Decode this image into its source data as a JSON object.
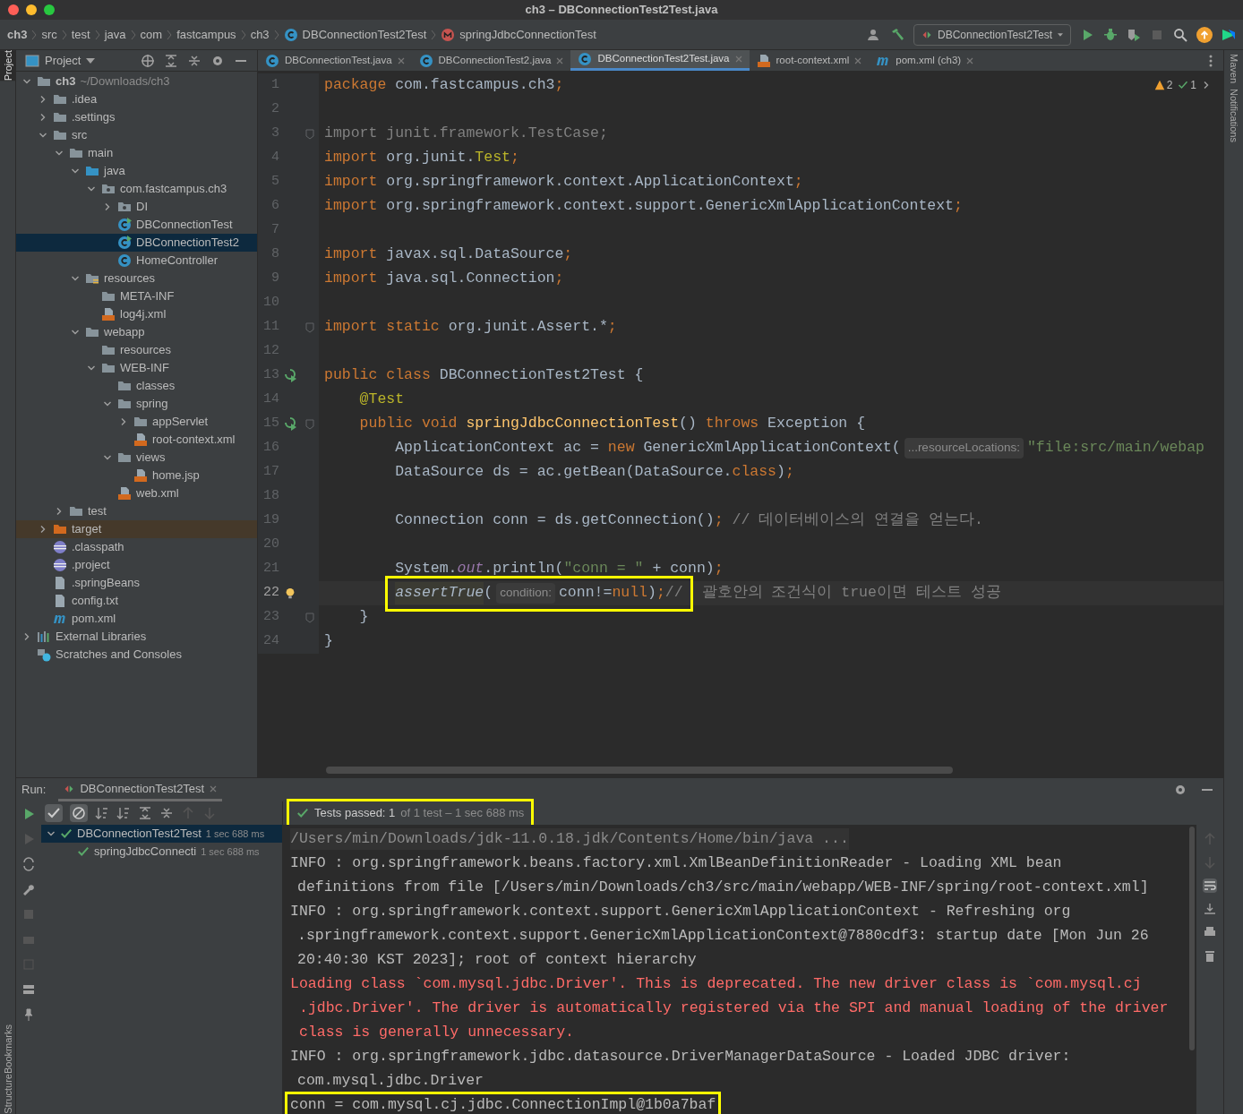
{
  "window": {
    "title": "ch3 – DBConnectionTest2Test.java"
  },
  "breadcrumbs": [
    {
      "label": "ch3",
      "kind": "root"
    },
    {
      "label": "src",
      "kind": "folder"
    },
    {
      "label": "test",
      "kind": "folder"
    },
    {
      "label": "java",
      "kind": "folder"
    },
    {
      "label": "com",
      "kind": "folder"
    },
    {
      "label": "fastcampus",
      "kind": "folder"
    },
    {
      "label": "ch3",
      "kind": "folder"
    },
    {
      "label": "DBConnectionTest2Test",
      "kind": "class"
    },
    {
      "label": "springJdbcConnectionTest",
      "kind": "method"
    }
  ],
  "run_config": {
    "label": "DBConnectionTest2Test"
  },
  "left_top_tool_windows": [
    {
      "label": "Project",
      "selected": true
    }
  ],
  "left_bottom_tool_windows": [
    {
      "label": "Bookmarks",
      "selected": false
    },
    {
      "label": "Structure",
      "selected": false
    }
  ],
  "right_tool_windows": [
    {
      "label": "Maven"
    },
    {
      "label": "Notifications"
    }
  ],
  "project_panel": {
    "title": "Project",
    "items": [
      {
        "label": "ch3",
        "path": "~/Downloads/ch3",
        "kind": "module",
        "expanded": true,
        "selected": false,
        "children": [
          {
            "label": ".idea",
            "kind": "folder",
            "expanded": false,
            "selected": false
          },
          {
            "label": ".settings",
            "kind": "folder",
            "expanded": false,
            "selected": false
          },
          {
            "label": "src",
            "kind": "folder",
            "expanded": true,
            "selected": false,
            "children": [
              {
                "label": "main",
                "kind": "folder",
                "expanded": true,
                "selected": false,
                "children": [
                  {
                    "label": "java",
                    "kind": "source-folder",
                    "expanded": true,
                    "selected": false,
                    "children": [
                      {
                        "label": "com.fastcampus.ch3",
                        "kind": "package",
                        "expanded": true,
                        "selected": false,
                        "children": [
                          {
                            "label": "DI",
                            "kind": "package",
                            "expanded": false,
                            "selected": false
                          },
                          {
                            "label": "DBConnectionTest",
                            "kind": "test-class",
                            "selected": false
                          },
                          {
                            "label": "DBConnectionTest2",
                            "kind": "test-class",
                            "selected": true
                          },
                          {
                            "label": "HomeController",
                            "kind": "class",
                            "selected": false
                          }
                        ]
                      }
                    ]
                  },
                  {
                    "label": "resources",
                    "kind": "resources-folder",
                    "expanded": true,
                    "selected": false,
                    "children": [
                      {
                        "label": "META-INF",
                        "kind": "folder",
                        "selected": false
                      },
                      {
                        "label": "log4j.xml",
                        "kind": "xml",
                        "selected": false
                      }
                    ]
                  },
                  {
                    "label": "webapp",
                    "kind": "folder",
                    "expanded": true,
                    "selected": false,
                    "children": [
                      {
                        "label": "resources",
                        "kind": "folder",
                        "selected": false
                      },
                      {
                        "label": "WEB-INF",
                        "kind": "folder",
                        "expanded": true,
                        "selected": false,
                        "children": [
                          {
                            "label": "classes",
                            "kind": "folder",
                            "selected": false
                          },
                          {
                            "label": "spring",
                            "kind": "folder",
                            "expanded": true,
                            "selected": false,
                            "children": [
                              {
                                "label": "appServlet",
                                "kind": "folder",
                                "expanded": false,
                                "selected": false
                              },
                              {
                                "label": "root-context.xml",
                                "kind": "xml",
                                "selected": false
                              }
                            ]
                          },
                          {
                            "label": "views",
                            "kind": "folder",
                            "expanded": true,
                            "selected": false,
                            "children": [
                              {
                                "label": "home.jsp",
                                "kind": "jsp",
                                "selected": false
                              }
                            ]
                          },
                          {
                            "label": "web.xml",
                            "kind": "xml",
                            "selected": false
                          }
                        ]
                      }
                    ]
                  }
                ]
              },
              {
                "label": "test",
                "kind": "folder",
                "expanded": false,
                "selected": false
              }
            ]
          },
          {
            "label": "target",
            "kind": "excluded-folder",
            "expanded": false,
            "selected": false
          },
          {
            "label": ".classpath",
            "kind": "eclipse",
            "selected": false
          },
          {
            "label": ".project",
            "kind": "eclipse",
            "selected": false
          },
          {
            "label": ".springBeans",
            "kind": "text",
            "selected": false
          },
          {
            "label": "config.txt",
            "kind": "text",
            "selected": false
          },
          {
            "label": "pom.xml",
            "kind": "maven",
            "selected": false
          }
        ]
      },
      {
        "label": "External Libraries",
        "kind": "libraries",
        "expanded": false,
        "selected": false
      },
      {
        "label": "Scratches and Consoles",
        "kind": "scratches",
        "selected": false
      }
    ]
  },
  "editor_tabs": [
    {
      "label": "DBConnectionTest.java",
      "kind": "class",
      "selected": false
    },
    {
      "label": "DBConnectionTest2.java",
      "kind": "class",
      "selected": false
    },
    {
      "label": "DBConnectionTest2Test.java",
      "kind": "class",
      "selected": true
    },
    {
      "label": "root-context.xml",
      "kind": "xml",
      "selected": false
    },
    {
      "label": "pom.xml (ch3)",
      "kind": "maven",
      "selected": false
    }
  ],
  "inspections": {
    "warnings": "2",
    "ok": "1"
  },
  "code_lines": [
    {
      "number": "1",
      "tokens": [
        {
          "kind": "kw",
          "text": "package "
        },
        {
          "kind": "plain",
          "text": "com.fastcampus.ch3"
        },
        {
          "kind": "kw",
          "text": ";"
        }
      ]
    },
    {
      "number": "2"
    },
    {
      "number": "3",
      "fold": true,
      "tokens": [
        {
          "kind": "unused",
          "text": "import junit.framework.TestCase;"
        }
      ]
    },
    {
      "number": "4",
      "tokens": [
        {
          "kind": "kw",
          "text": "import "
        },
        {
          "kind": "plain",
          "text": "org.junit."
        },
        {
          "kind": "annot",
          "text": "Test"
        },
        {
          "kind": "kw",
          "text": ";"
        }
      ]
    },
    {
      "number": "5",
      "tokens": [
        {
          "kind": "kw",
          "text": "import "
        },
        {
          "kind": "plain",
          "text": "org.springframework.context.ApplicationContext"
        },
        {
          "kind": "kw",
          "text": ";"
        }
      ]
    },
    {
      "number": "6",
      "tokens": [
        {
          "kind": "kw",
          "text": "import "
        },
        {
          "kind": "plain",
          "text": "org.springframework.context.support.GenericXmlApplicationContext"
        },
        {
          "kind": "kw",
          "text": ";"
        }
      ]
    },
    {
      "number": "7"
    },
    {
      "number": "8",
      "tokens": [
        {
          "kind": "kw",
          "text": "import "
        },
        {
          "kind": "plain",
          "text": "javax.sql.DataSource"
        },
        {
          "kind": "kw",
          "text": ";"
        }
      ]
    },
    {
      "number": "9",
      "tokens": [
        {
          "kind": "kw",
          "text": "import "
        },
        {
          "kind": "plain",
          "text": "java.sql.Connection"
        },
        {
          "kind": "kw",
          "text": ";"
        }
      ]
    },
    {
      "number": "10"
    },
    {
      "number": "11",
      "fold": true,
      "tokens": [
        {
          "kind": "kw",
          "text": "import static "
        },
        {
          "kind": "plain",
          "text": "org.junit.Assert.*"
        },
        {
          "kind": "kw",
          "text": ";"
        }
      ]
    },
    {
      "number": "12"
    },
    {
      "number": "13",
      "run_marker": true,
      "tokens": [
        {
          "kind": "kw",
          "text": "public class "
        },
        {
          "kind": "plain",
          "text": "DBConnectionTest2Test {"
        }
      ]
    },
    {
      "number": "14",
      "tokens": [
        {
          "kind": "annot",
          "text": "    @Test"
        }
      ]
    },
    {
      "number": "15",
      "run_marker": true,
      "fold": true,
      "tokens": [
        {
          "kind": "kw",
          "text": "    public void "
        },
        {
          "kind": "method",
          "text": "springJdbcConnectionTest"
        },
        {
          "kind": "plain",
          "text": "() "
        },
        {
          "kind": "kw",
          "text": "throws "
        },
        {
          "kind": "plain",
          "text": "Exception {"
        }
      ]
    },
    {
      "number": "16",
      "tokens": [
        {
          "kind": "plain",
          "text": "        ApplicationContext ac = "
        },
        {
          "kind": "kw",
          "text": "new "
        },
        {
          "kind": "plain",
          "text": "GenericXmlApplicationContext("
        },
        {
          "kind": "hint",
          "text": "...resourceLocations:"
        },
        {
          "kind": "str",
          "text": "\"file:src/main/webap"
        }
      ]
    },
    {
      "number": "17",
      "tokens": [
        {
          "kind": "plain",
          "text": "        DataSource ds = ac.getBean(DataSource."
        },
        {
          "kind": "kw",
          "text": "class"
        },
        {
          "kind": "plain",
          "text": ")"
        },
        {
          "kind": "kw",
          "text": ";"
        }
      ]
    },
    {
      "number": "18"
    },
    {
      "number": "19",
      "tokens": [
        {
          "kind": "plain",
          "text": "        Connection conn = ds.getConnection()"
        },
        {
          "kind": "kw",
          "text": ";"
        },
        {
          "kind": "comment",
          "text": " // 데이터베이스의 연결을 얻는다."
        }
      ]
    },
    {
      "number": "20"
    },
    {
      "number": "21",
      "tokens": [
        {
          "kind": "plain",
          "text": "        System."
        },
        {
          "kind": "field",
          "text": "out"
        },
        {
          "kind": "plain",
          "text": ".println("
        },
        {
          "kind": "str",
          "text": "\"conn = \""
        },
        {
          "kind": "plain",
          "text": " + conn)"
        },
        {
          "kind": "kw",
          "text": ";"
        }
      ]
    },
    {
      "number": "22",
      "bulb": true,
      "current": true,
      "highlighted_tokens": [
        {
          "kind": "static",
          "text": "assertTrue"
        },
        {
          "kind": "plain",
          "text": "("
        },
        {
          "kind": "hint",
          "text": "condition:"
        },
        {
          "kind": "plain",
          "text": "conn!="
        },
        {
          "kind": "kw",
          "text": "null"
        },
        {
          "kind": "plain",
          "text": ")"
        },
        {
          "kind": "kw",
          "text": ";"
        },
        {
          "kind": "comment",
          "text": "//"
        }
      ],
      "tokens": [
        {
          "kind": "comment",
          "text": " 괄호안의 조건식이 true이면 테스트 성공"
        }
      ]
    },
    {
      "number": "23",
      "fold": true,
      "tokens": [
        {
          "kind": "plain",
          "text": "    }"
        }
      ]
    },
    {
      "number": "24",
      "tokens": [
        {
          "kind": "plain",
          "text": "}"
        }
      ]
    }
  ],
  "run_panel": {
    "label": "Run:",
    "tab": "DBConnectionTest2Test",
    "status": {
      "label": "Tests passed: 1",
      "detail": "of 1 test – 1 sec 688 ms",
      "highlighted": true
    },
    "tests": [
      {
        "label": "DBConnectionTest2Test",
        "time": "1 sec 688 ms",
        "expanded": true,
        "selected": true,
        "children": [
          {
            "label": "springJdbcConnecti",
            "time": "1 sec 688 ms",
            "selected": false
          }
        ]
      }
    ],
    "console": [
      {
        "kind": "command",
        "highlighted": false,
        "text": "/Users/min/Downloads/jdk-11.0.18.jdk/Contents/Home/bin/java ..."
      },
      {
        "kind": "log",
        "highlighted": false,
        "text": "INFO : org.springframework.beans.factory.xml.XmlBeanDefinitionReader - Loading XML bean"
      },
      {
        "kind": "log",
        "highlighted": false,
        "wrapped": true,
        "text": "definitions from file [/Users/min/Downloads/ch3/src/main/webapp/WEB-INF/spring/root-context.xml]"
      },
      {
        "kind": "log",
        "highlighted": false,
        "text": "INFO : org.springframework.context.support.GenericXmlApplicationContext - Refreshing org"
      },
      {
        "kind": "log",
        "highlighted": false,
        "wrapped": true,
        "text": ".springframework.context.support.GenericXmlApplicationContext@7880cdf3: startup date [Mon Jun 26"
      },
      {
        "kind": "log",
        "highlighted": false,
        "wrapped": true,
        "text": "20:40:30 KST 2023]; root of context hierarchy"
      },
      {
        "kind": "error",
        "highlighted": false,
        "text": "Loading class `com.mysql.jdbc.Driver'. This is deprecated. The new driver class is `com.mysql.cj"
      },
      {
        "kind": "error",
        "highlighted": false,
        "wrapped": true,
        "text": ".jdbc.Driver'. The driver is automatically registered via the SPI and manual loading of the driver"
      },
      {
        "kind": "error",
        "highlighted": false,
        "wrapped": true,
        "text": "class is generally unnecessary."
      },
      {
        "kind": "log",
        "highlighted": false,
        "text": "INFO : org.springframework.jdbc.datasource.DriverManagerDataSource - Loaded JDBC driver:"
      },
      {
        "kind": "log",
        "highlighted": false,
        "wrapped": true,
        "text": "com.mysql.jdbc.Driver"
      },
      {
        "kind": "log",
        "highlighted": true,
        "text": "conn = com.mysql.cj.jdbc.ConnectionImpl@1b0a7baf"
      }
    ]
  }
}
